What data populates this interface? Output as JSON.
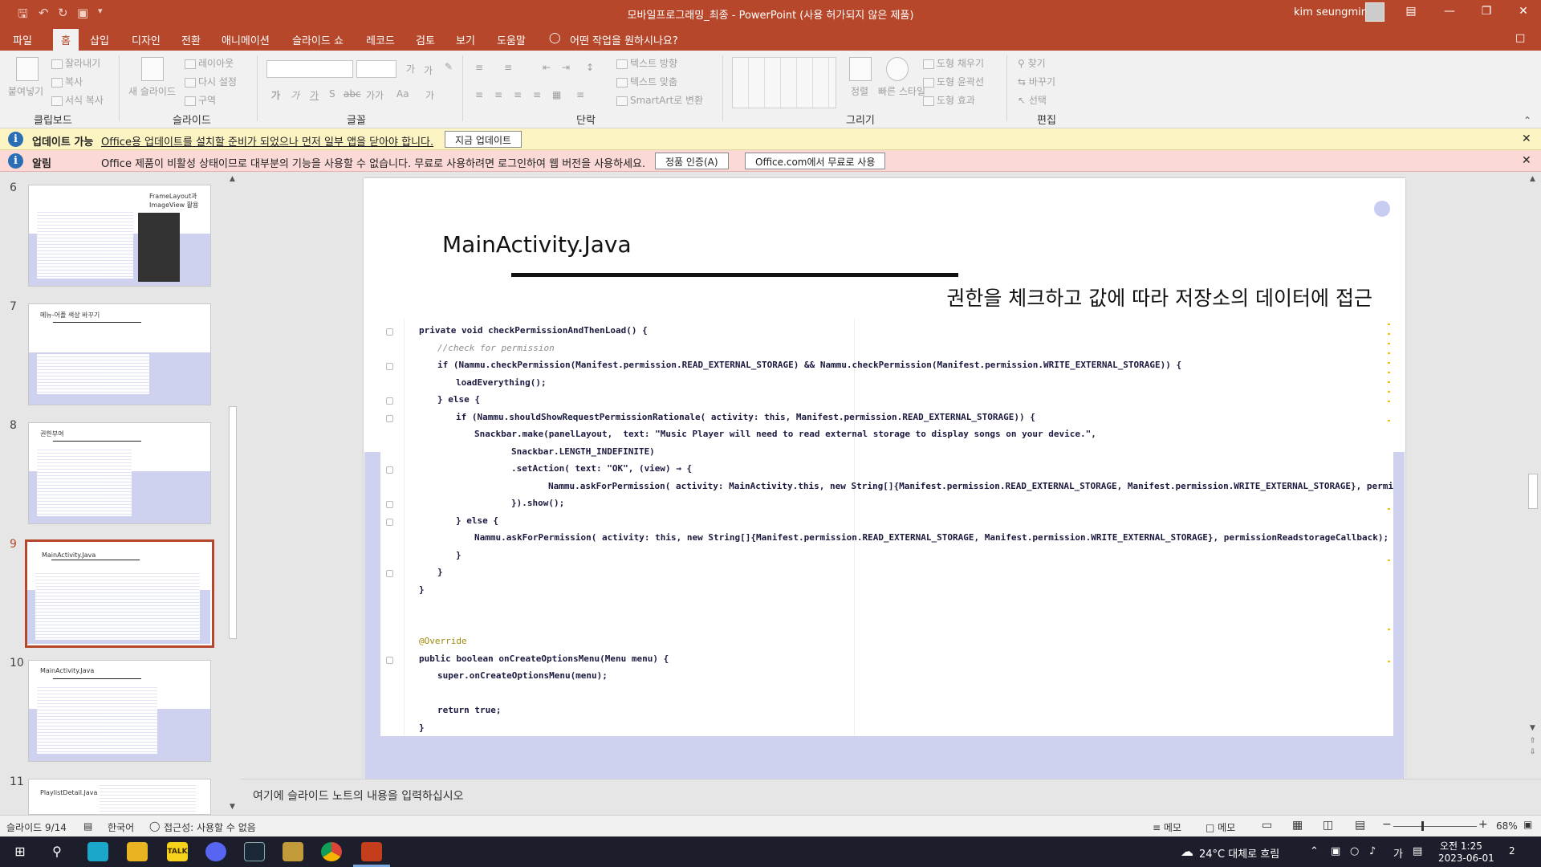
{
  "window": {
    "title": "모바일프로그래밍_최종  -  PowerPoint (사용 허가되지 않은 제품)",
    "user": "kim seungmin",
    "qat_icons": [
      "save-icon",
      "undo-icon",
      "redo-icon",
      "start-from-beginning-icon",
      "customize-icon"
    ]
  },
  "tabs": [
    "파일",
    "홈",
    "삽입",
    "디자인",
    "전환",
    "애니메이션",
    "슬라이드 쇼",
    "레코드",
    "검토",
    "보기",
    "도움말"
  ],
  "active_tab": "홈",
  "tell_me": "어떤 작업을 원하시나요?",
  "ribbon": {
    "clipboard": {
      "label": "클립보드",
      "paste": "붙여넣기",
      "cut": "잘라내기",
      "copy": "복사",
      "format_painter": "서식 복사"
    },
    "slides": {
      "label": "슬라이드",
      "new_slide": "새 슬라이드",
      "layout": "레이아웃",
      "reset": "다시 설정",
      "section": "구역"
    },
    "font": {
      "label": "글꼴",
      "buttons": [
        "가",
        "가",
        "가",
        "S",
        "abc",
        "가가",
        "Aa",
        "가"
      ]
    },
    "paragraph": {
      "label": "단락",
      "text_direction": "텍스트 방향",
      "align_text": "텍스트 맞춤",
      "smartart": "SmartArt로 변환"
    },
    "drawing": {
      "label": "그리기",
      "arrange": "정렬",
      "quick_styles": "빠른 스타일",
      "shape_fill": "도형 채우기",
      "shape_outline": "도형 윤곽선",
      "shape_effects": "도형 효과"
    },
    "editing": {
      "label": "편집",
      "find": "찾기",
      "replace": "바꾸기",
      "select": "선택"
    }
  },
  "update_bar": {
    "title": "업데이트 가능",
    "message": "Office용 업데이트를 설치할 준비가 되었으나 먼저 일부 앱을 닫아야 합니다.",
    "button": "지금 업데이트"
  },
  "alert_bar": {
    "title": "알림",
    "message": "Office 제품이 비활성 상태이므로 대부분의 기능을 사용할 수 없습니다. 무료로 사용하려면 로그인하여 웹 버전을 사용하세요.",
    "button1": "정품 인증(A)",
    "button2": "Office.com에서 무료로 사용"
  },
  "thumbnails": [
    {
      "num": "6",
      "title": "FrameLayout과 ImageView 활용",
      "selected": false
    },
    {
      "num": "7",
      "title": "메뉴-어플 색상 바꾸기",
      "selected": false
    },
    {
      "num": "8",
      "title": "권한부여",
      "selected": false
    },
    {
      "num": "9",
      "title": "MainActivity.Java",
      "selected": true
    },
    {
      "num": "10",
      "title": "MainActivity.Java",
      "selected": false
    },
    {
      "num": "11",
      "title": "PlaylistDetail.Java",
      "selected": false
    }
  ],
  "slide": {
    "title": "MainActivity.Java",
    "subtitle": "권한을 체크하고 값에 따라 저장소의 데이터에 접근",
    "code_lines": [
      {
        "indent": 0,
        "text": "private void checkPermissionAndThenLoad() {",
        "kind": "code"
      },
      {
        "indent": 1,
        "text": "//check for permission",
        "kind": "comment"
      },
      {
        "indent": 1,
        "text": "if (Nammu.checkPermission(Manifest.permission.READ_EXTERNAL_STORAGE) && Nammu.checkPermission(Manifest.permission.WRITE_EXTERNAL_STORAGE)) {",
        "kind": "code"
      },
      {
        "indent": 2,
        "text": "loadEverything();",
        "kind": "code"
      },
      {
        "indent": 1,
        "text": "} else {",
        "kind": "code"
      },
      {
        "indent": 2,
        "text": "if (Nammu.shouldShowRequestPermissionRationale( activity: this, Manifest.permission.READ_EXTERNAL_STORAGE)) {",
        "kind": "code"
      },
      {
        "indent": 3,
        "text": "Snackbar.make(panelLayout,  text: \"Music Player will need to read external storage to display songs on your device.\",",
        "kind": "code"
      },
      {
        "indent": 5,
        "text": "Snackbar.LENGTH_INDEFINITE)",
        "kind": "code"
      },
      {
        "indent": 5,
        "text": ".setAction( text: \"OK\", (view) → {",
        "kind": "code"
      },
      {
        "indent": 7,
        "text": "Nammu.askForPermission( activity: MainActivity.this, new String[]{Manifest.permission.READ_EXTERNAL_STORAGE, Manifest.permission.WRITE_EXTERNAL_STORAGE}, permissionReadstorageCallback);",
        "kind": "code"
      },
      {
        "indent": 5,
        "text": "}).show();",
        "kind": "code"
      },
      {
        "indent": 2,
        "text": "} else {",
        "kind": "code"
      },
      {
        "indent": 3,
        "text": "Nammu.askForPermission( activity: this, new String[]{Manifest.permission.READ_EXTERNAL_STORAGE, Manifest.permission.WRITE_EXTERNAL_STORAGE}, permissionReadstorageCallback);",
        "kind": "code"
      },
      {
        "indent": 2,
        "text": "}",
        "kind": "code"
      },
      {
        "indent": 1,
        "text": "}",
        "kind": "code"
      },
      {
        "indent": 0,
        "text": "}",
        "kind": "code"
      },
      {
        "indent": 0,
        "text": "",
        "kind": "code"
      },
      {
        "indent": 0,
        "text": "",
        "kind": "code"
      },
      {
        "indent": 0,
        "text": "@Override",
        "kind": "annotation"
      },
      {
        "indent": 0,
        "text": "public boolean onCreateOptionsMenu(Menu menu) {",
        "kind": "code"
      },
      {
        "indent": 1,
        "text": "super.onCreateOptionsMenu(menu);",
        "kind": "code"
      },
      {
        "indent": 0,
        "text": "",
        "kind": "code"
      },
      {
        "indent": 1,
        "text": "return true;",
        "kind": "code"
      },
      {
        "indent": 0,
        "text": "}",
        "kind": "code"
      }
    ]
  },
  "notes_placeholder": "여기에 슬라이드 노트의 내용을 입력하십시오",
  "status": {
    "slide": "슬라이드 9/14",
    "language": "한국어",
    "accessibility": "접근성: 사용할 수 없음",
    "notes1": "메모",
    "notes2": "메모",
    "zoom": "68%",
    "zoom_fraction": 0.68
  },
  "taskbar": {
    "weather": "24°C  대체로 흐림",
    "ime": "가",
    "time": "오전 1:25",
    "date": "2023-06-01",
    "notifications": "2",
    "apps": [
      "start-icon",
      "search-icon",
      "browser-icon",
      "explorer-icon",
      "kakaotalk-icon",
      "discord-icon",
      "steam-icon",
      "league-icon",
      "chrome-icon",
      "powerpoint-icon"
    ],
    "kakao_label": "TALK"
  },
  "colors": {
    "accent": "#b7472a",
    "slide_band": "#cfd2ef",
    "update_bar": "#fcf4c2",
    "alert_bar": "#fbd9d7"
  }
}
